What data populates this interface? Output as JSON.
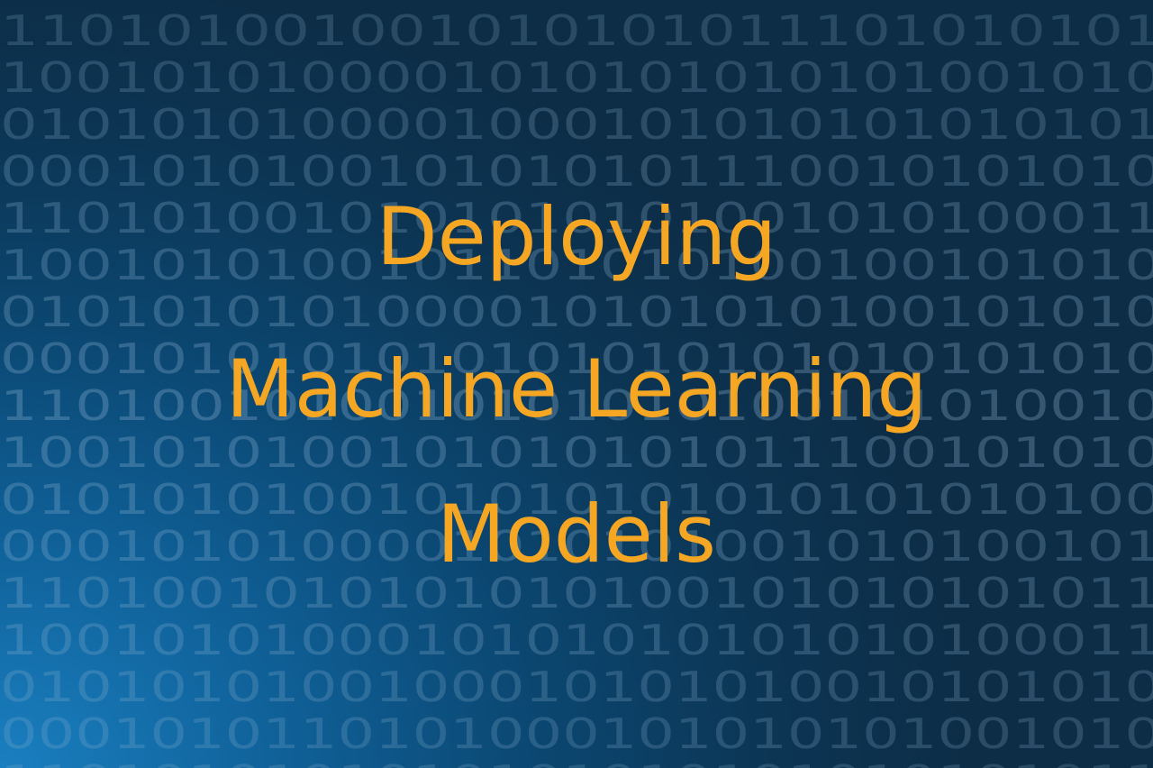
{
  "headline": {
    "line1": "Deploying",
    "line2": "Machine Learning",
    "line3": "Models"
  },
  "background": {
    "pattern": "binary-digits",
    "rows": [
      "110101001001010101011101010101",
      "1001010100001010101010101001010",
      "0101010100001000101010101010101",
      "0001010100101010101110010101010",
      "1101010010101010101001010100011",
      "1001010100101101010100100101010",
      "0101010101000010101010100101010",
      "0001010101010101010101010101010",
      "1101001010010101010100101010010",
      "1001010100101010101011100101010",
      "0101010100101010101010101010100",
      "0001010100001010101001010100101",
      "1101001010101010100101010101011",
      "1001010100010101010101010100011",
      "0101010100100010101010010101010",
      "0001010110101000101010101001010",
      "1101010101010101010101010101011"
    ],
    "colors": {
      "gradient_bright": "#1a7fc0",
      "gradient_dark": "#0d2c45",
      "digit": "#8fb5d3"
    }
  },
  "colors": {
    "headline": "#f5a623"
  }
}
